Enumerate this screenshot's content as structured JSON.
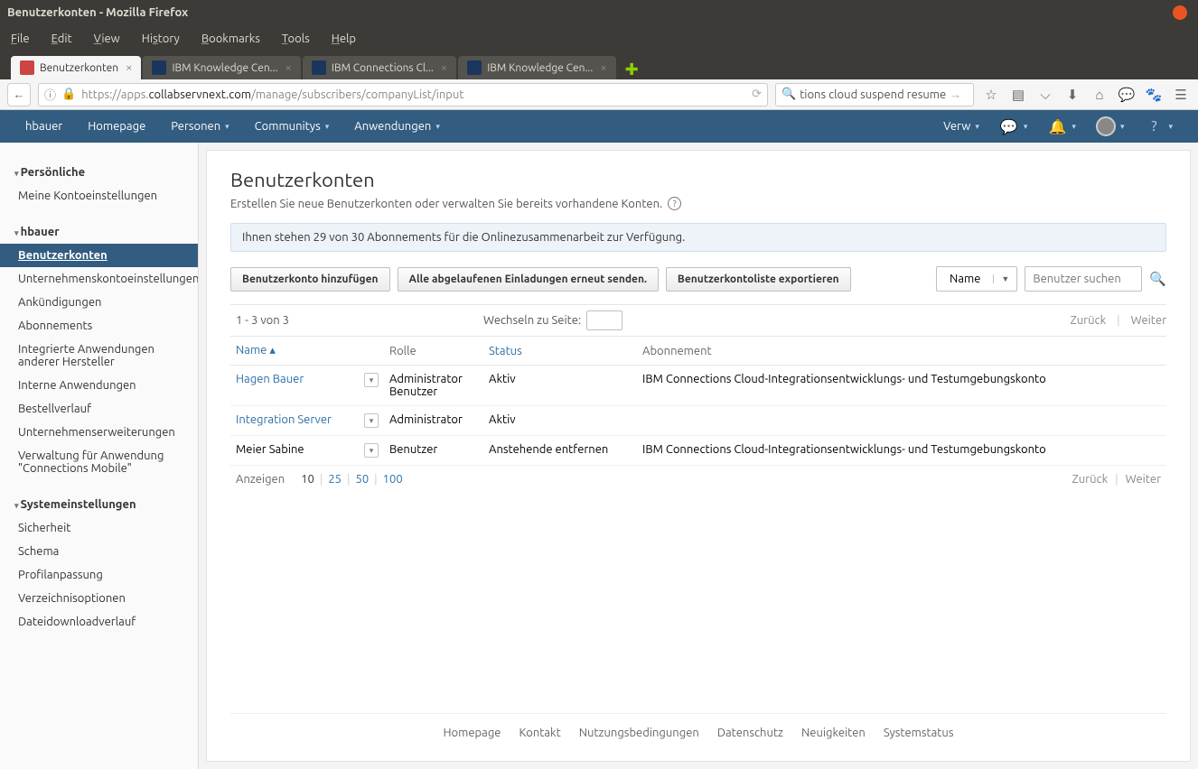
{
  "window_title": "Benutzerkonten - Mozilla Firefox",
  "menubar": [
    "File",
    "Edit",
    "View",
    "History",
    "Bookmarks",
    "Tools",
    "Help"
  ],
  "tabs": [
    {
      "label": "Benutzerkonten",
      "active": true,
      "favicon": "#c44"
    },
    {
      "label": "IBM Knowledge Cen...",
      "active": false,
      "favicon": "#1b365d"
    },
    {
      "label": "IBM Connections Cl...",
      "active": false,
      "favicon": "#1b365d"
    },
    {
      "label": "IBM Knowledge Cen...",
      "active": false,
      "favicon": "#1b365d"
    }
  ],
  "url": {
    "pre": "https://apps.",
    "host": "collabservnext.com",
    "post": "/manage/subscribers/companyList/input"
  },
  "browser_search": "tions cloud suspend resume",
  "appnav": {
    "left": [
      "hbauer",
      "Homepage",
      "Personen",
      "Communitys",
      "Anwendungen"
    ],
    "verw": "Verw"
  },
  "sidebar": {
    "sect1": "Persönliche",
    "s1": [
      "Meine Kontoeinstellungen"
    ],
    "sect2": "hbauer",
    "s2": [
      "Benutzerkonten",
      "Unternehmenskontoeinstellungen",
      "Ankündigungen",
      "Abonnements",
      "Integrierte Anwendungen anderer Hersteller",
      "Interne Anwendungen",
      "Bestellverlauf",
      "Unternehmenserweiterungen",
      "Verwaltung für Anwendung \"Connections Mobile\""
    ],
    "sect3": "Systemeinstellungen",
    "s3": [
      "Sicherheit",
      "Schema",
      "Profilanpassung",
      "Verzeichnisoptionen",
      "Dateidownloadverlauf"
    ]
  },
  "content": {
    "title": "Benutzerkonten",
    "subtitle": "Erstellen Sie neue Benutzerkonten oder verwalten Sie bereits vorhandene Konten.",
    "info": "Ihnen stehen 29 von 30 Abonnements für die Onlinezusammenarbeit zur Verfügung.",
    "btn_add": "Benutzerkonto hinzufügen",
    "btn_resend": "Alle abgelaufenen Einladungen erneut senden.",
    "btn_export": "Benutzerkontoliste exportieren",
    "filter_field": "Name",
    "search_placeholder": "Benutzer suchen",
    "range": "1 - 3 von 3",
    "goto_label": "Wechseln zu Seite:",
    "prev": "Zurück",
    "next": "Weiter",
    "columns": {
      "name": "Name",
      "role": "Rolle",
      "status": "Status",
      "sub": "Abonnement"
    },
    "rows": [
      {
        "name": "Hagen Bauer",
        "role": "Administrator Benutzer",
        "status": "Aktiv",
        "sub": "IBM Connections Cloud-Integrationsentwicklungs- und Testumgebungskonto",
        "link": true
      },
      {
        "name": "Integration Server",
        "role": "Administrator",
        "status": "Aktiv",
        "sub": "",
        "link": true
      },
      {
        "name": "Meier Sabine",
        "role": "Benutzer",
        "status": "Anstehende entfernen",
        "sub": "IBM Connections Cloud-Integrationsentwicklungs- und Testumgebungskonto",
        "link": false
      }
    ],
    "show_label": "Anzeigen",
    "page_sizes": [
      "10",
      "25",
      "50",
      "100"
    ]
  },
  "footer": [
    "Homepage",
    "Kontakt",
    "Nutzungsbedingungen",
    "Datenschutz",
    "Neuigkeiten",
    "Systemstatus"
  ]
}
